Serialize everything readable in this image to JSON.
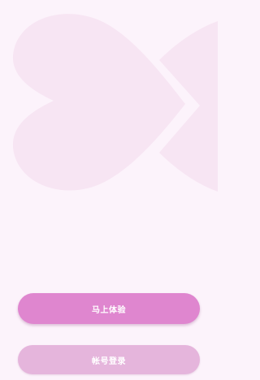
{
  "buttons": {
    "try_now_label": "马上体验",
    "account_login_label": "帐号登录"
  },
  "colors": {
    "background": "#fcf3fb",
    "heart_decoration": "#f6e3f2",
    "primary_button": "#df86cf",
    "secondary_button": "#e5b5dc"
  }
}
